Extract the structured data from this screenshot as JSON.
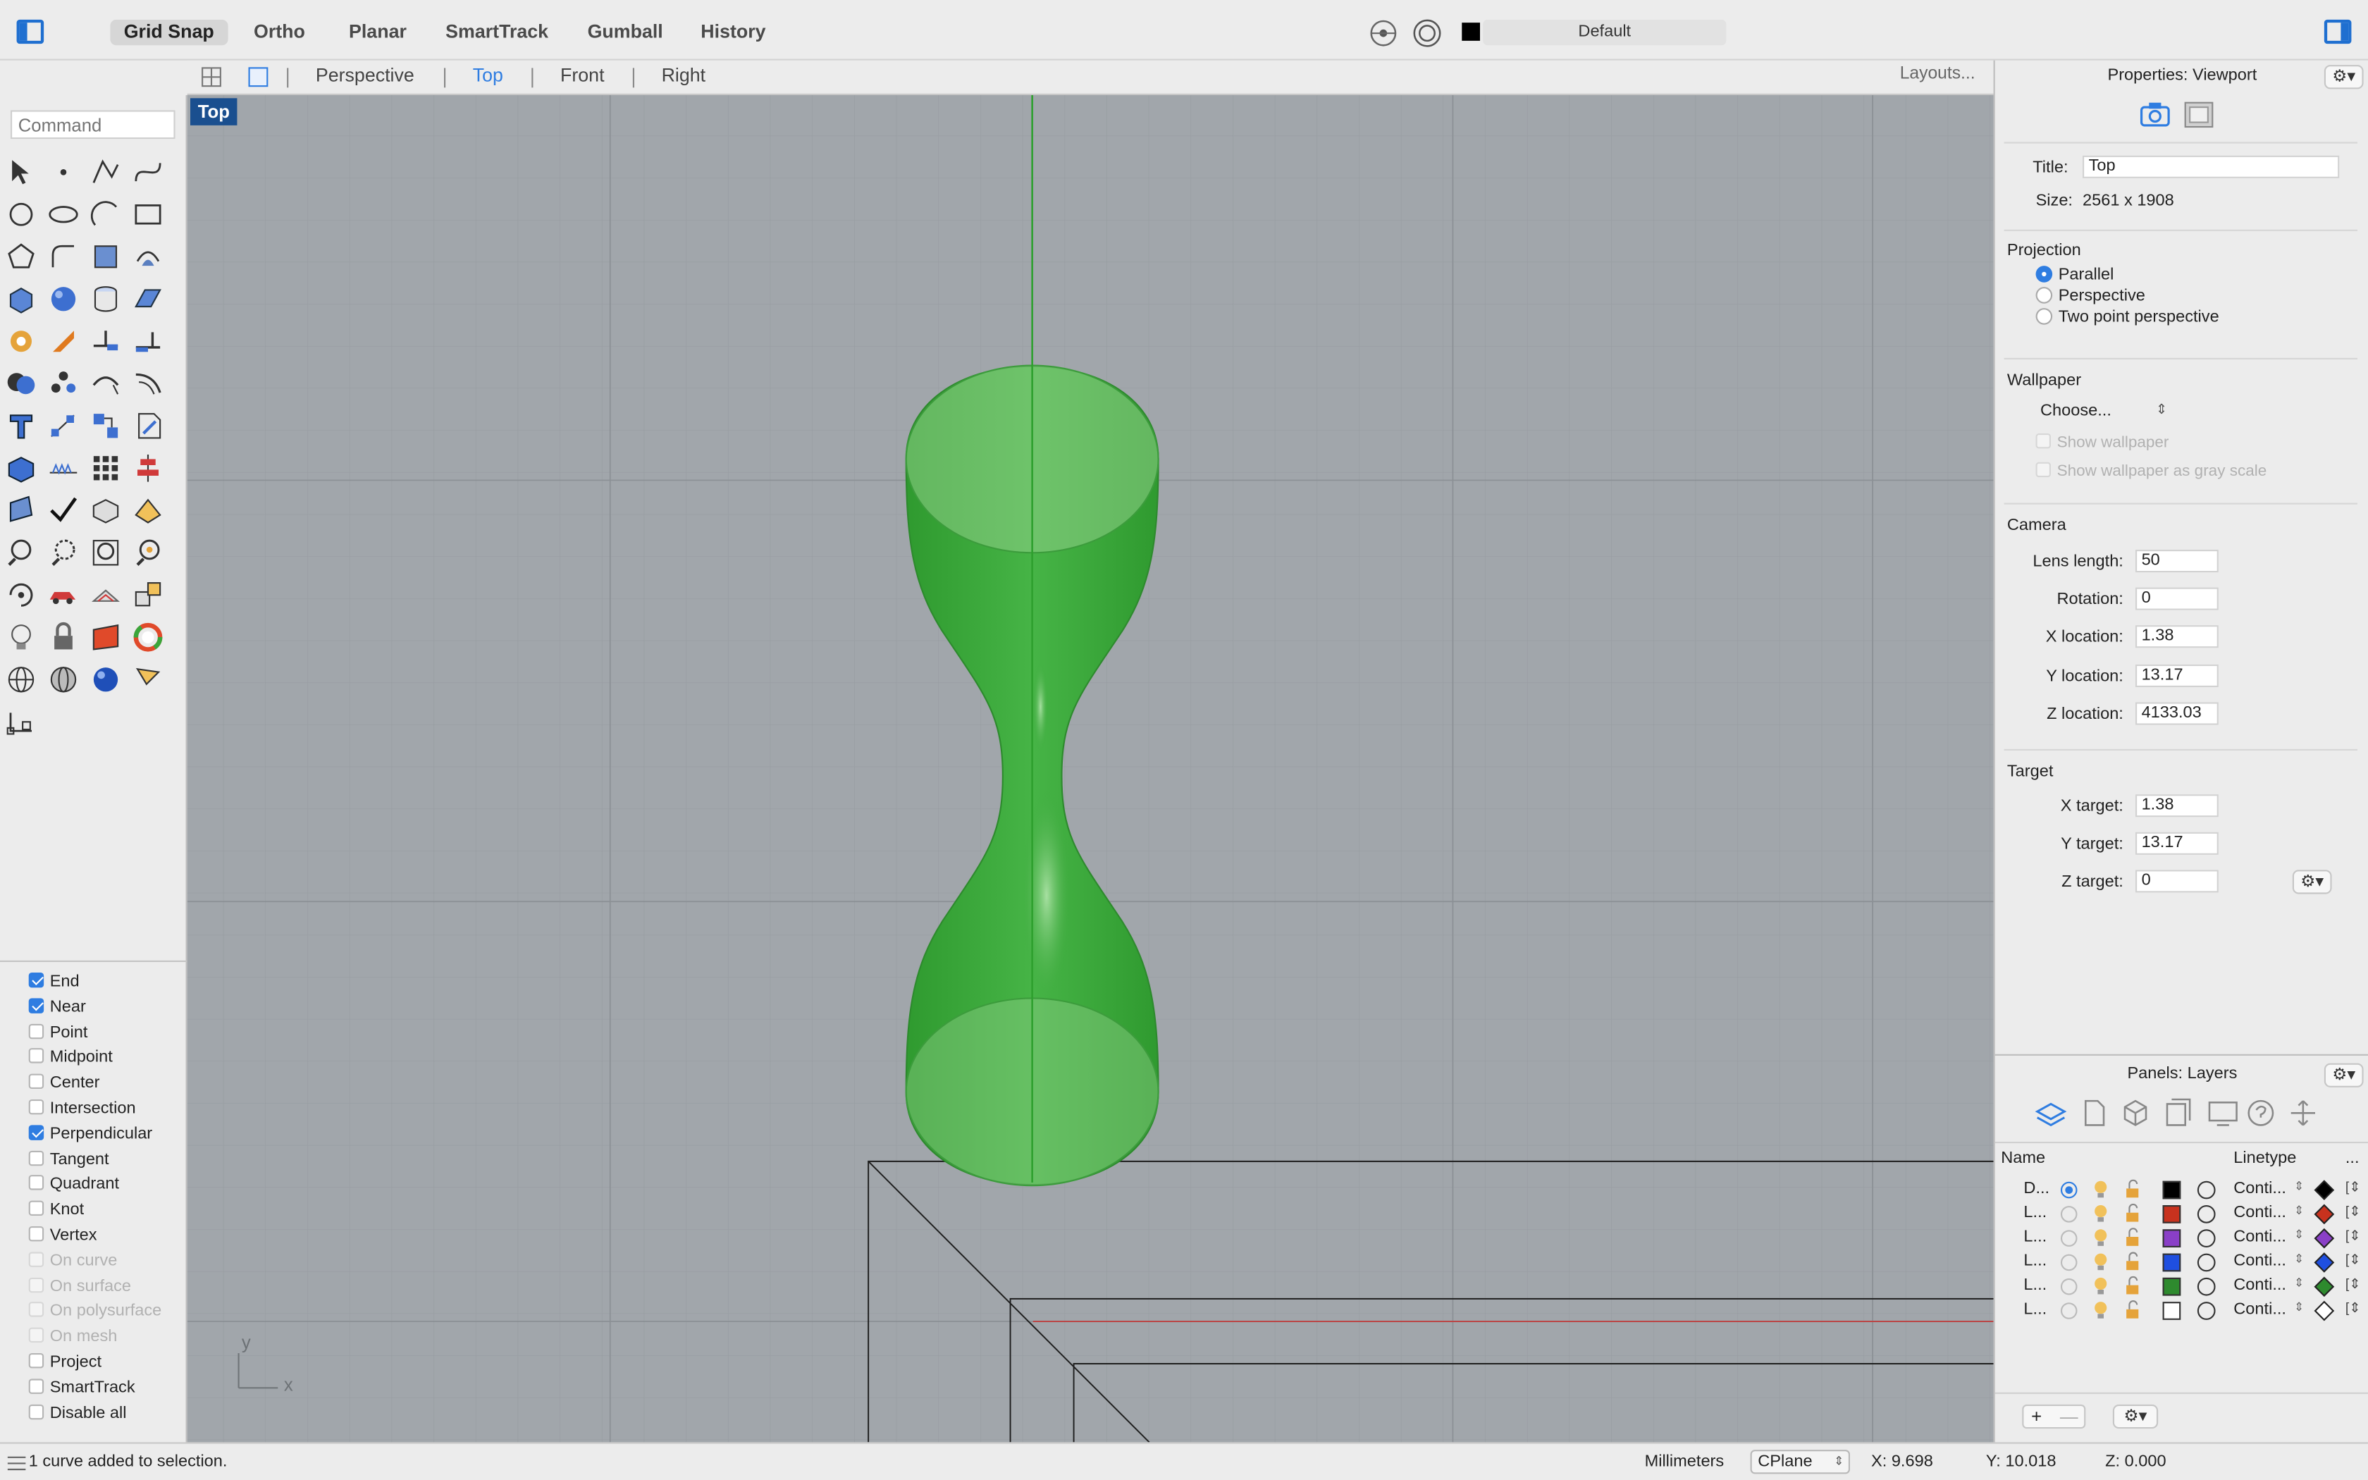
{
  "toolbar": {
    "buttons": [
      "Grid Snap",
      "Ortho",
      "Planar",
      "SmartTrack",
      "Gumball",
      "History"
    ],
    "layer_name": "Default"
  },
  "viewport_tabs": {
    "tabs": [
      "Perspective",
      "Top",
      "Front",
      "Right"
    ],
    "active": "Top",
    "layouts": "Layouts..."
  },
  "command": {
    "placeholder": "Command"
  },
  "viewport": {
    "label": "Top",
    "axis_x": "x",
    "axis_y": "y",
    "object_color": "#3aa63a"
  },
  "osnaps": {
    "items": [
      {
        "label": "End",
        "checked": true,
        "enabled": true
      },
      {
        "label": "Near",
        "checked": true,
        "enabled": true
      },
      {
        "label": "Point",
        "checked": false,
        "enabled": true
      },
      {
        "label": "Midpoint",
        "checked": false,
        "enabled": true
      },
      {
        "label": "Center",
        "checked": false,
        "enabled": true
      },
      {
        "label": "Intersection",
        "checked": false,
        "enabled": true
      },
      {
        "label": "Perpendicular",
        "checked": true,
        "enabled": true
      },
      {
        "label": "Tangent",
        "checked": false,
        "enabled": true
      },
      {
        "label": "Quadrant",
        "checked": false,
        "enabled": true
      },
      {
        "label": "Knot",
        "checked": false,
        "enabled": true
      },
      {
        "label": "Vertex",
        "checked": false,
        "enabled": true
      },
      {
        "label": "On curve",
        "checked": false,
        "enabled": false
      },
      {
        "label": "On surface",
        "checked": false,
        "enabled": false
      },
      {
        "label": "On polysurface",
        "checked": false,
        "enabled": false
      },
      {
        "label": "On mesh",
        "checked": false,
        "enabled": false
      },
      {
        "label": "Project",
        "checked": false,
        "enabled": true
      },
      {
        "label": "SmartTrack",
        "checked": false,
        "enabled": true
      },
      {
        "label": "Disable all",
        "checked": false,
        "enabled": true
      }
    ]
  },
  "properties": {
    "header": "Properties: Viewport",
    "title_label": "Title:",
    "title_value": "Top",
    "size_label": "Size:",
    "size_value": "2561 x 1908",
    "projection": {
      "heading": "Projection",
      "options": [
        "Parallel",
        "Perspective",
        "Two point perspective"
      ],
      "selected": "Parallel"
    },
    "wallpaper": {
      "heading": "Wallpaper",
      "choose": "Choose...",
      "show": "Show wallpaper",
      "gray": "Show wallpaper as gray scale"
    },
    "camera": {
      "heading": "Camera",
      "fields": [
        {
          "label": "Lens length:",
          "value": "50"
        },
        {
          "label": "Rotation:",
          "value": "0"
        },
        {
          "label": "X location:",
          "value": "1.38"
        },
        {
          "label": "Y location:",
          "value": "13.17"
        },
        {
          "label": "Z location:",
          "value": "4133.03"
        }
      ]
    },
    "target": {
      "heading": "Target",
      "fields": [
        {
          "label": "X target:",
          "value": "1.38"
        },
        {
          "label": "Y target:",
          "value": "13.17"
        },
        {
          "label": "Z target:",
          "value": "0"
        }
      ]
    }
  },
  "layers": {
    "header": "Panels: Layers",
    "col_name": "Name",
    "col_linetype": "Linetype",
    "col_more": "...",
    "rows": [
      {
        "name": "D...",
        "current": true,
        "color": "#000000",
        "linetype": "Conti...",
        "mat": "#000000"
      },
      {
        "name": "L...",
        "current": false,
        "color": "#c8321e",
        "linetype": "Conti...",
        "mat": "#c8321e"
      },
      {
        "name": "L...",
        "current": false,
        "color": "#8a3fc7",
        "linetype": "Conti...",
        "mat": "#8a3fc7"
      },
      {
        "name": "L...",
        "current": false,
        "color": "#1f4fe0",
        "linetype": "Conti...",
        "mat": "#1f4fe0"
      },
      {
        "name": "L...",
        "current": false,
        "color": "#2e8a2e",
        "linetype": "Conti...",
        "mat": "#2e8a2e"
      },
      {
        "name": "L...",
        "current": false,
        "color": "#ffffff",
        "linetype": "Conti...",
        "mat": "#ffffff"
      }
    ],
    "add": "+",
    "remove": "—"
  },
  "status": {
    "message": "1 curve added to selection.",
    "units": "Millimeters",
    "cplane": "CPlane",
    "x": "X: 9.698",
    "y": "Y: 10.018",
    "z": "Z: 0.000"
  }
}
